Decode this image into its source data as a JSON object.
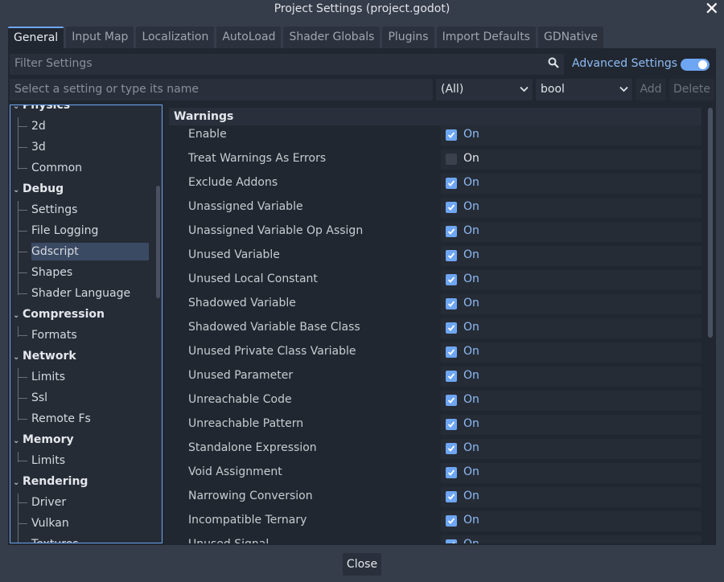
{
  "window": {
    "title": "Project Settings (project.godot)",
    "close_glyph": "✕"
  },
  "tabs": [
    "General",
    "Input Map",
    "Localization",
    "AutoLoad",
    "Shader Globals",
    "Plugins",
    "Import Defaults",
    "GDNative"
  ],
  "filter": {
    "placeholder": "Filter Settings"
  },
  "advanced": {
    "label": "Advanced Settings",
    "enabled": true
  },
  "add_setting": {
    "placeholder": "Select a setting or type its name",
    "scope": "(All)",
    "type": "bool",
    "add_label": "Add",
    "delete_label": "Delete"
  },
  "tree": [
    {
      "label": "Physics",
      "kind": "cat"
    },
    {
      "label": "2d",
      "kind": "leaf"
    },
    {
      "label": "3d",
      "kind": "leaf"
    },
    {
      "label": "Common",
      "kind": "leaf"
    },
    {
      "label": "Debug",
      "kind": "cat"
    },
    {
      "label": "Settings",
      "kind": "leaf"
    },
    {
      "label": "File Logging",
      "kind": "leaf"
    },
    {
      "label": "Gdscript",
      "kind": "leaf",
      "selected": true
    },
    {
      "label": "Shapes",
      "kind": "leaf"
    },
    {
      "label": "Shader Language",
      "kind": "leaf"
    },
    {
      "label": "Compression",
      "kind": "cat"
    },
    {
      "label": "Formats",
      "kind": "leaf"
    },
    {
      "label": "Network",
      "kind": "cat"
    },
    {
      "label": "Limits",
      "kind": "leaf"
    },
    {
      "label": "Ssl",
      "kind": "leaf"
    },
    {
      "label": "Remote Fs",
      "kind": "leaf"
    },
    {
      "label": "Memory",
      "kind": "cat"
    },
    {
      "label": "Limits",
      "kind": "leaf"
    },
    {
      "label": "Rendering",
      "kind": "cat"
    },
    {
      "label": "Driver",
      "kind": "leaf"
    },
    {
      "label": "Vulkan",
      "kind": "leaf"
    },
    {
      "label": "Textures",
      "kind": "leaf"
    }
  ],
  "section": {
    "title": "Warnings"
  },
  "settings": [
    {
      "label": "Enable",
      "checked": true,
      "value_label": "On"
    },
    {
      "label": "Treat Warnings As Errors",
      "checked": false,
      "value_label": "On"
    },
    {
      "label": "Exclude Addons",
      "checked": true,
      "value_label": "On"
    },
    {
      "label": "Unassigned Variable",
      "checked": true,
      "value_label": "On"
    },
    {
      "label": "Unassigned Variable Op Assign",
      "checked": true,
      "value_label": "On"
    },
    {
      "label": "Unused Variable",
      "checked": true,
      "value_label": "On"
    },
    {
      "label": "Unused Local Constant",
      "checked": true,
      "value_label": "On"
    },
    {
      "label": "Shadowed Variable",
      "checked": true,
      "value_label": "On"
    },
    {
      "label": "Shadowed Variable Base Class",
      "checked": true,
      "value_label": "On"
    },
    {
      "label": "Unused Private Class Variable",
      "checked": true,
      "value_label": "On"
    },
    {
      "label": "Unused Parameter",
      "checked": true,
      "value_label": "On"
    },
    {
      "label": "Unreachable Code",
      "checked": true,
      "value_label": "On"
    },
    {
      "label": "Unreachable Pattern",
      "checked": true,
      "value_label": "On"
    },
    {
      "label": "Standalone Expression",
      "checked": true,
      "value_label": "On"
    },
    {
      "label": "Void Assignment",
      "checked": true,
      "value_label": "On"
    },
    {
      "label": "Narrowing Conversion",
      "checked": true,
      "value_label": "On"
    },
    {
      "label": "Incompatible Ternary",
      "checked": true,
      "value_label": "On"
    },
    {
      "label": "Unused Signal",
      "checked": true,
      "value_label": "On"
    }
  ],
  "footer": {
    "close_label": "Close"
  },
  "colors": {
    "accent": "#6ea6f4",
    "background": "#363d4a",
    "panel": "#212730"
  }
}
